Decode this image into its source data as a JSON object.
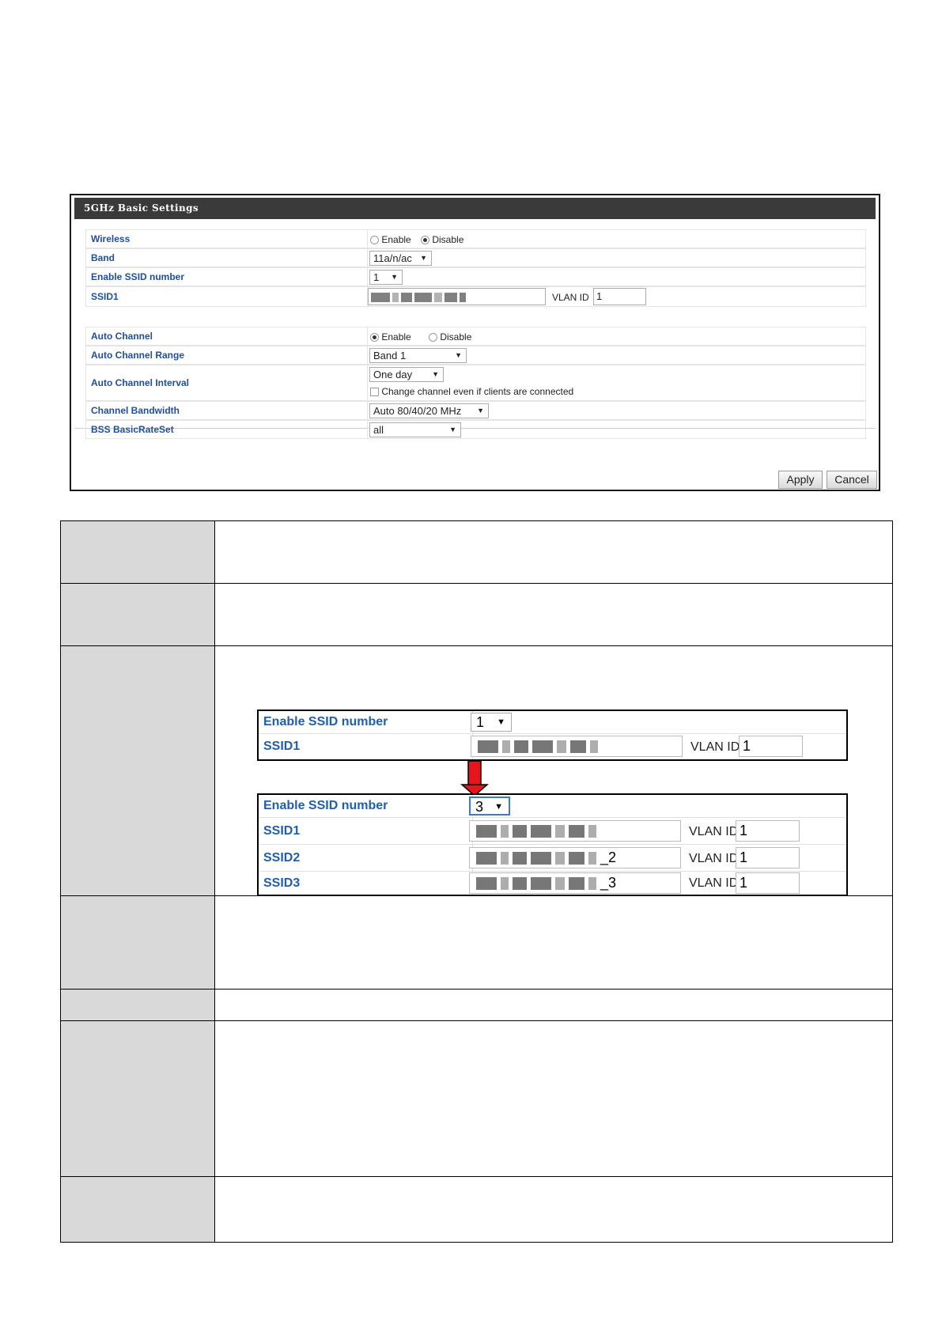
{
  "panel": {
    "title": "5GHz Basic Settings",
    "rows": {
      "wireless": {
        "label": "Wireless",
        "opt_enable": "Enable",
        "opt_disable": "Disable",
        "selected": "Disable"
      },
      "band": {
        "label": "Band",
        "value": "11a/n/ac"
      },
      "ssid_number": {
        "label": "Enable SSID number",
        "value": "1"
      },
      "ssid1": {
        "label": "SSID1",
        "vlan_label": "VLAN ID",
        "vlan_value": "1"
      },
      "auto_channel": {
        "label": "Auto Channel",
        "opt_enable": "Enable",
        "opt_disable": "Disable",
        "selected": "Enable"
      },
      "auto_channel_range": {
        "label": "Auto Channel Range",
        "value": "Band 1"
      },
      "auto_channel_interval": {
        "label": "Auto Channel Interval",
        "value": "One day",
        "checkbox_label": "Change channel even if clients are connected"
      },
      "channel_bandwidth": {
        "label": "Channel Bandwidth",
        "value": "Auto 80/40/20 MHz"
      },
      "bss_basic_rate_set": {
        "label": "BSS BasicRateSet",
        "value": "all"
      }
    },
    "buttons": {
      "apply": "Apply",
      "cancel": "Cancel"
    }
  },
  "illustration": {
    "before": {
      "ssid_number_label": "Enable SSID number",
      "ssid_number_value": "1",
      "ssid1_label": "SSID1",
      "vlan_label": "VLAN ID",
      "vlan_value": "1"
    },
    "after": {
      "ssid_number_label": "Enable SSID number",
      "ssid_number_value": "3",
      "rows": [
        {
          "label": "SSID1",
          "suffix": "",
          "vlan_label": "VLAN ID",
          "vlan_value": "1"
        },
        {
          "label": "SSID2",
          "suffix": "_2",
          "vlan_label": "VLAN ID",
          "vlan_value": "1"
        },
        {
          "label": "SSID3",
          "suffix": "_3",
          "vlan_label": "VLAN ID",
          "vlan_value": "1"
        }
      ]
    },
    "arrow_color": "#e8141b"
  },
  "arrow_glyph": "▼"
}
